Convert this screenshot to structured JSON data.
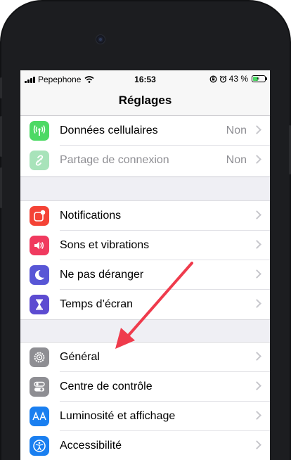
{
  "status_bar": {
    "carrier": "Pepephone",
    "time": "16:53",
    "battery_text": "43 %",
    "battery_level": 0.43
  },
  "nav": {
    "title": "Réglages"
  },
  "groups": [
    {
      "items": [
        {
          "label": "Données cellulaires",
          "value": "Non",
          "icon": "antenna-icon",
          "color": "#4cd964",
          "dim": false
        },
        {
          "label": "Partage de connexion",
          "value": "Non",
          "icon": "link-icon",
          "color": "#a8e3ba",
          "dim": true
        }
      ]
    },
    {
      "items": [
        {
          "label": "Notifications",
          "icon": "notifications-icon",
          "color": "#f44336"
        },
        {
          "label": "Sons et vibrations",
          "icon": "speaker-icon",
          "color": "#f03a5f"
        },
        {
          "label": "Ne pas déranger",
          "icon": "moon-icon",
          "color": "#5856d6"
        },
        {
          "label": "Temps d’écran",
          "icon": "hourglass-icon",
          "color": "#5c4bd1"
        }
      ]
    },
    {
      "items": [
        {
          "label": "Général",
          "icon": "gear-icon",
          "color": "#8e8e93"
        },
        {
          "label": "Centre de contrôle",
          "icon": "toggles-icon",
          "color": "#8e8e93"
        },
        {
          "label": "Luminosité et affichage",
          "icon": "text-size-icon",
          "color": "#1a7ff0"
        },
        {
          "label": "Accessibilité",
          "icon": "accessibility-icon",
          "color": "#1a7ff0"
        }
      ]
    }
  ],
  "annotation": {
    "arrow_color": "#ef3b4c"
  }
}
